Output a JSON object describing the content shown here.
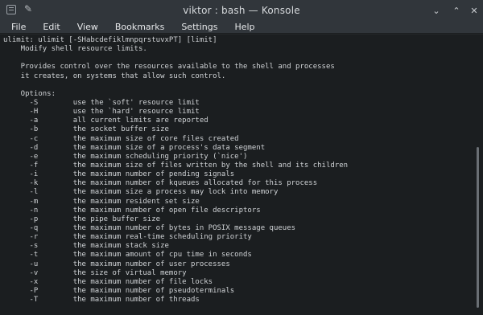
{
  "window": {
    "title": "viktor : bash — Konsole",
    "pin_glyph": "✎",
    "minimize_glyph": "⌄",
    "maximize_glyph": "⌃",
    "close_glyph": "✕"
  },
  "menu": [
    "File",
    "Edit",
    "View",
    "Bookmarks",
    "Settings",
    "Help"
  ],
  "terminal": {
    "lines": [
      "ulimit: ulimit [-SHabcdefiklmnpqrstuvxPT] [limit]",
      "    Modify shell resource limits.",
      "",
      "    Provides control over the resources available to the shell and processes",
      "    it creates, on systems that allow such control.",
      "",
      "    Options:",
      "      -S        use the `soft' resource limit",
      "      -H        use the `hard' resource limit",
      "      -a        all current limits are reported",
      "      -b        the socket buffer size",
      "      -c        the maximum size of core files created",
      "      -d        the maximum size of a process's data segment",
      "      -e        the maximum scheduling priority (`nice')",
      "      -f        the maximum size of files written by the shell and its children",
      "      -i        the maximum number of pending signals",
      "      -k        the maximum number of kqueues allocated for this process",
      "      -l        the maximum size a process may lock into memory",
      "      -m        the maximum resident set size",
      "      -n        the maximum number of open file descriptors",
      "      -p        the pipe buffer size",
      "      -q        the maximum number of bytes in POSIX message queues",
      "      -r        the maximum real-time scheduling priority",
      "      -s        the maximum stack size",
      "      -t        the maximum amount of cpu time in seconds",
      "      -u        the maximum number of user processes",
      "      -v        the size of virtual memory",
      "      -x        the maximum number of file locks",
      "      -P        the maximum number of pseudoterminals",
      "      -T        the maximum number of threads"
    ]
  }
}
